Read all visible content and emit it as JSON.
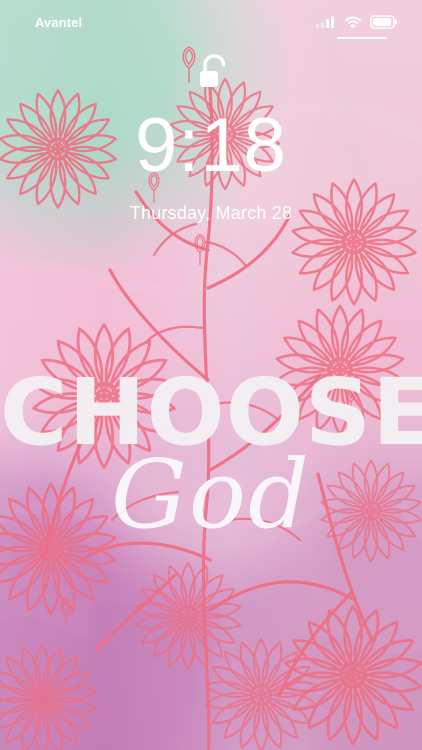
{
  "status_bar": {
    "carrier": "Avantel",
    "icons": [
      "signal-icon",
      "wifi-icon",
      "battery-icon"
    ]
  },
  "lock_screen": {
    "lock_icon": "unlocked-padlock-icon",
    "time": "9:18",
    "date": "Thursday, March 28"
  },
  "wallpaper": {
    "headline": "CHOOSE",
    "subheadline": "God"
  },
  "colors": {
    "status_text": "#ffffff",
    "flower_outline": "#ef6f83",
    "wallpaper_text": "#f2eff2"
  }
}
